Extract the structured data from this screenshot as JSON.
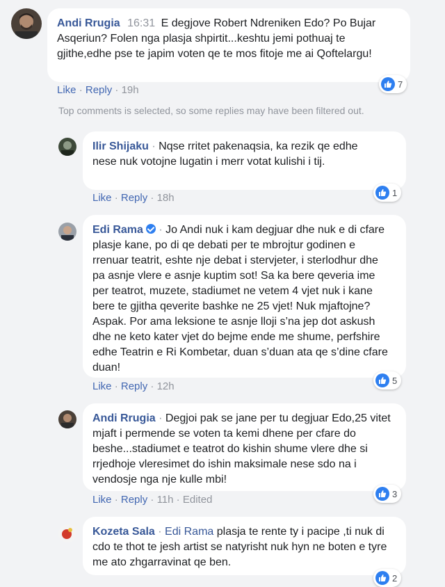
{
  "top_comment": {
    "author": "Andi Rrugia",
    "time": "16:31",
    "text": "E degjove Robert Ndreniken Edo? Po Bujar Asqeriun? Folen nga plasja shpirtit...keshtu jemi pothuaj te gjithe,edhe pse te japim voten qe te mos fitoje me ai Qoftelargu!",
    "like_label": "Like",
    "reply_label": "Reply",
    "age": "19h",
    "reactions": "7"
  },
  "filter_notice": "Top comments is selected, so some replies may have been filtered out.",
  "replies": [
    {
      "author": "Ilir Shijaku",
      "text": "Nqse rritet pakenaqsia, ka rezik qe edhe nese nuk votojne lugatin i merr votat kulishi i tij.",
      "like_label": "Like",
      "reply_label": "Reply",
      "age": "18h",
      "reactions": "1"
    },
    {
      "author": "Edi Rama",
      "text": "Jo Andi nuk i kam degjuar dhe nuk e di cfare plasje kane, po di qe debati per te mbrojtur godinen e rrenuar teatrit, eshte nje debat i stervjeter, i sterlodhur dhe pa asnje vlere e asnje kuptim sot! Sa ka bere qeveria ime per teatrot, muzete, stadiumet ne vetem 4 vjet nuk i kane bere te gjitha qeverite bashke ne 25 vjet! Nuk mjaftojne? Aspak. Por ama leksione te asnje lloji s’na jep dot askush dhe ne keto kater vjet do bejme ende me shume, perfshire edhe Teatrin e Ri Kombetar, duan s’duan ata qe s’dine cfare duan!",
      "like_label": "Like",
      "reply_label": "Reply",
      "age": "12h",
      "reactions": "5"
    },
    {
      "author": "Andi Rrugia",
      "text": "Degjoi pak se jane per tu degjuar Edo,25 vitet mjaft i permende se voten ta kemi dhene per cfare do beshe...stadiumet e teatrot do kishin shume vlere dhe si rrjedhoje vleresimet do ishin maksimale nese sdo na i vendosje nga nje kulle mbi!",
      "like_label": "Like",
      "reply_label": "Reply",
      "age": "11h",
      "edited": "Edited",
      "reactions": "3"
    },
    {
      "author": "Kozeta Sala",
      "mention": "Edi Rama",
      "text": "plasja te rente ty i pacipe ,ti nuk di cdo te thot te jesh artist se natyrisht nuk hyn ne boten e tyre me ato zhgarravinat qe ben.",
      "reactions": "2"
    }
  ],
  "colors": {
    "link": "#385898",
    "action": "#4267b2",
    "meta": "#90949c",
    "like_blue": "#2e7ff0",
    "bubble": "#ffffff",
    "page": "#f2f3f5"
  }
}
